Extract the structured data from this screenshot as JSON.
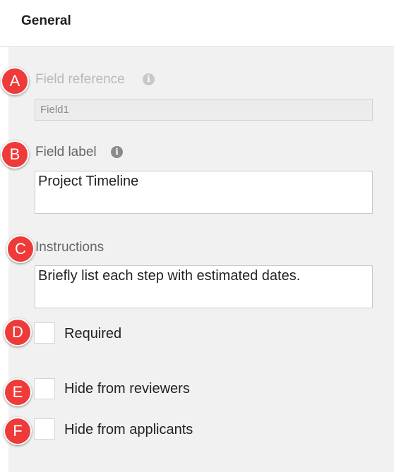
{
  "header": {
    "title": "General"
  },
  "fields": {
    "reference": {
      "label": "Field reference",
      "value": "Field1",
      "disabled": true
    },
    "label": {
      "label": "Field label",
      "value": "Project Timeline"
    },
    "instructions": {
      "label": "Instructions",
      "value": "Briefly list each step with estimated dates."
    }
  },
  "checkboxes": {
    "required": {
      "label": "Required",
      "checked": false
    },
    "hide_reviewers": {
      "label": "Hide from reviewers",
      "checked": false
    },
    "hide_applicants": {
      "label": "Hide from applicants",
      "checked": false
    }
  },
  "icons": {
    "info": "i"
  },
  "badges": [
    "A",
    "B",
    "C",
    "D",
    "E",
    "F"
  ],
  "colors": {
    "badge": "#ee3b39",
    "panel": "#f1f1f1"
  }
}
